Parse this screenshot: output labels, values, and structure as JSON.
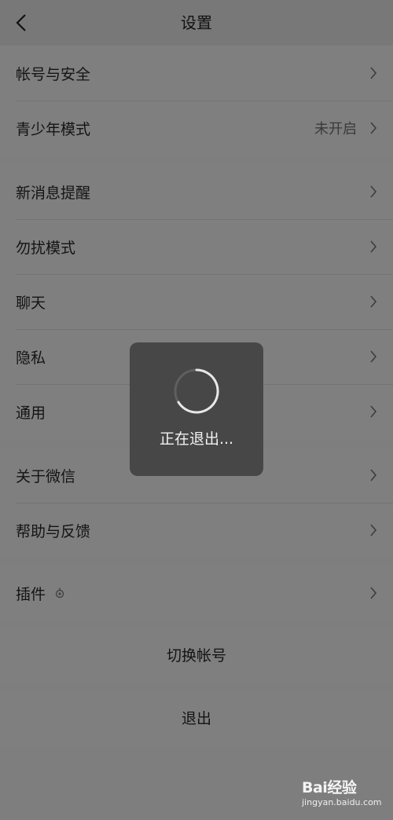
{
  "header": {
    "title": "设置",
    "back_icon": "back-arrow-icon"
  },
  "groups": [
    {
      "items": [
        {
          "label": "帐号与安全",
          "value": ""
        },
        {
          "label": "青少年模式",
          "value": "未开启"
        }
      ]
    },
    {
      "items": [
        {
          "label": "新消息提醒"
        },
        {
          "label": "勿扰模式"
        },
        {
          "label": "聊天"
        },
        {
          "label": "隐私"
        },
        {
          "label": "通用"
        }
      ]
    },
    {
      "items": [
        {
          "label": "关于微信"
        },
        {
          "label": "帮助与反馈"
        }
      ]
    },
    {
      "items": [
        {
          "label": "插件",
          "icon": "plugin-icon"
        }
      ]
    }
  ],
  "actions": {
    "switch_account": "切换帐号",
    "logout": "退出"
  },
  "toast": {
    "text": "正在退出..."
  },
  "watermark": {
    "brand": "Bai经验",
    "url": "jingyan.baidu.com"
  },
  "colors": {
    "overlay_background": "#7e7e7e",
    "toast_background": "#474747"
  }
}
